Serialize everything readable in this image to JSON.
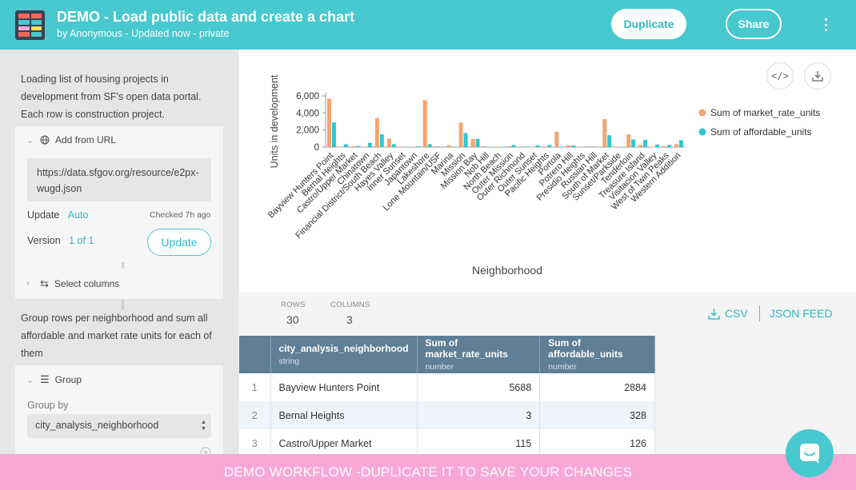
{
  "header": {
    "title": "DEMO - Load public data and create a chart",
    "subtitle": "by Anonymous - Updated now - private",
    "duplicate_label": "Duplicate",
    "share_label": "Share"
  },
  "sidebar": {
    "step1_desc": "Loading list of housing projects in development from SF's open data portal. Each row is construction project.",
    "add_from_url": {
      "title": "Add from URL",
      "url": "https://data.sfgov.org/resource/e2px-wugd.json",
      "update_label": "Update",
      "update_mode": "Auto",
      "checked": "Checked 7h ago",
      "version_label": "Version",
      "version_value": "1 of 1",
      "update_button": "Update"
    },
    "select_columns": {
      "title": "Select columns"
    },
    "step3_desc": "Group rows per neighborhood and sum all affordable and market rate units for each of them",
    "group": {
      "title": "Group",
      "group_by_label": "Group by",
      "group_by_value": "city_analysis_neighborhood"
    }
  },
  "stats": {
    "rows_label": "ROWS",
    "rows_value": "30",
    "columns_label": "COLUMNS",
    "columns_value": "3"
  },
  "export": {
    "csv": "CSV",
    "json": "JSON FEED"
  },
  "table": {
    "columns": [
      {
        "name": "city_analysis_neighborhood",
        "type": "string"
      },
      {
        "name": "Sum of market_rate_units",
        "type": "number"
      },
      {
        "name": "Sum of affordable_units",
        "type": "number"
      }
    ],
    "rows": [
      {
        "idx": "1",
        "neighborhood": "Bayview Hunters Point",
        "market": "5688",
        "affordable": "2884"
      },
      {
        "idx": "2",
        "neighborhood": "Bernal Heights",
        "market": "3",
        "affordable": "328"
      },
      {
        "idx": "3",
        "neighborhood": "Castro/Upper Market",
        "market": "115",
        "affordable": "126"
      }
    ]
  },
  "banner": "DEMO WORKFLOW -DUPLICATE IT TO SAVE YOUR CHANGES",
  "colors": {
    "accent": "#48c8cf",
    "market": "#f7a46f",
    "affordable": "#2ec7cf",
    "banner": "#f9a8d6",
    "table_header": "#5f7f95"
  },
  "chart_data": {
    "type": "bar",
    "xlabel": "Neighborhood",
    "ylabel": "Units in development",
    "ylim": [
      0,
      6000
    ],
    "yticks": [
      0,
      2000,
      4000,
      6000
    ],
    "ytick_labels": [
      "0",
      "2,000",
      "4,000",
      "6,000"
    ],
    "legend_position": "right",
    "categories": [
      "Bayview Hunters Point",
      "Bernal Heights",
      "Castro/Upper Market",
      "Chinatown",
      "Financial District/South Beach",
      "Hayes Valley",
      "Inner Sunset",
      "Japantown",
      "Lakeshore",
      "Lone Mountain/USF",
      "Marina",
      "Mission",
      "Mission Bay",
      "Nob Hill",
      "North Beach",
      "Outer Mission",
      "Outer Richmond",
      "Outer Sunset",
      "Pacific Heights",
      "Portola",
      "Potrero Hill",
      "Presidio Heights",
      "Russian Hill",
      "South of Market",
      "Sunset/Parkside",
      "Tenderloin",
      "Treasure Island",
      "Visitacion Valley",
      "West of Twin Peaks",
      "Western Addition"
    ],
    "series": [
      {
        "name": "Sum of market_rate_units",
        "color": "#f7a46f",
        "values": [
          5688,
          3,
          115,
          50,
          3400,
          1000,
          30,
          60,
          5500,
          100,
          200,
          2900,
          950,
          100,
          50,
          100,
          60,
          20,
          50,
          1800,
          200,
          30,
          100,
          3300,
          50,
          1500,
          250,
          50,
          100,
          350
        ]
      },
      {
        "name": "Sum of affordable_units",
        "color": "#2ec7cf",
        "values": [
          2884,
          328,
          126,
          500,
          1500,
          350,
          50,
          100,
          350,
          50,
          50,
          1650,
          950,
          50,
          50,
          250,
          50,
          200,
          250,
          50,
          200,
          50,
          50,
          1400,
          50,
          900,
          850,
          300,
          250,
          800
        ]
      }
    ]
  }
}
